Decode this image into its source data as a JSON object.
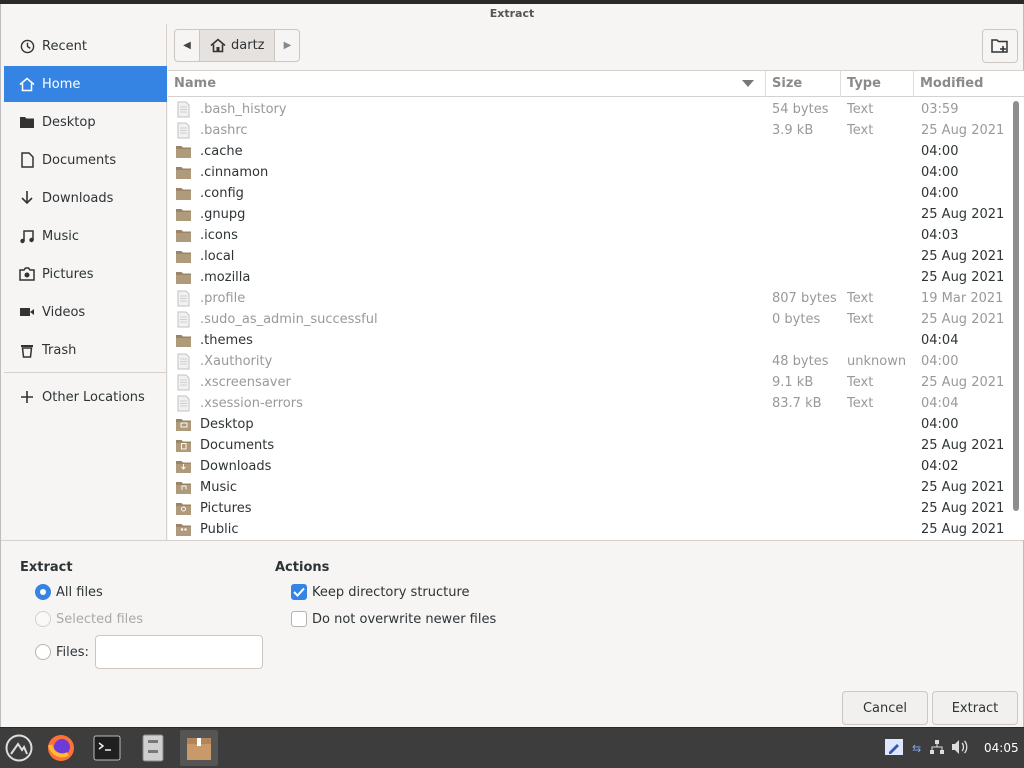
{
  "window": {
    "title": "Extract"
  },
  "sidebar": {
    "items": [
      {
        "label": "Recent",
        "icon": "clock-icon"
      },
      {
        "label": "Home",
        "icon": "home-icon"
      },
      {
        "label": "Desktop",
        "icon": "desktop-folder-icon"
      },
      {
        "label": "Documents",
        "icon": "document-icon"
      },
      {
        "label": "Downloads",
        "icon": "download-icon"
      },
      {
        "label": "Music",
        "icon": "music-icon"
      },
      {
        "label": "Pictures",
        "icon": "camera-icon"
      },
      {
        "label": "Videos",
        "icon": "video-icon"
      },
      {
        "label": "Trash",
        "icon": "trash-icon"
      }
    ],
    "other_locations": "Other Locations"
  },
  "pathbar": {
    "crumb": "dartz"
  },
  "columns": {
    "name": "Name",
    "size": "Size",
    "type": "Type",
    "modified": "Modified"
  },
  "files": [
    {
      "name": ".bash_history",
      "size": "54 bytes",
      "type": "Text",
      "modified": "03:59",
      "kind": "file",
      "hidden": true
    },
    {
      "name": ".bashrc",
      "size": "3.9 kB",
      "type": "Text",
      "modified": "25 Aug 2021",
      "kind": "file",
      "hidden": true
    },
    {
      "name": ".cache",
      "size": "",
      "type": "",
      "modified": "04:00",
      "kind": "folder",
      "hidden": false
    },
    {
      "name": ".cinnamon",
      "size": "",
      "type": "",
      "modified": "04:00",
      "kind": "folder",
      "hidden": false
    },
    {
      "name": ".config",
      "size": "",
      "type": "",
      "modified": "04:00",
      "kind": "folder",
      "hidden": false
    },
    {
      "name": ".gnupg",
      "size": "",
      "type": "",
      "modified": "25 Aug 2021",
      "kind": "folder",
      "hidden": false
    },
    {
      "name": ".icons",
      "size": "",
      "type": "",
      "modified": "04:03",
      "kind": "folder",
      "hidden": false
    },
    {
      "name": ".local",
      "size": "",
      "type": "",
      "modified": "25 Aug 2021",
      "kind": "folder",
      "hidden": false
    },
    {
      "name": ".mozilla",
      "size": "",
      "type": "",
      "modified": "25 Aug 2021",
      "kind": "folder",
      "hidden": false
    },
    {
      "name": ".profile",
      "size": "807 bytes",
      "type": "Text",
      "modified": "19 Mar 2021",
      "kind": "file",
      "hidden": true
    },
    {
      "name": ".sudo_as_admin_successful",
      "size": "0 bytes",
      "type": "Text",
      "modified": "25 Aug 2021",
      "kind": "file",
      "hidden": true
    },
    {
      "name": ".themes",
      "size": "",
      "type": "",
      "modified": "04:04",
      "kind": "folder",
      "hidden": false
    },
    {
      "name": ".Xauthority",
      "size": "48 bytes",
      "type": "unknown",
      "modified": "04:00",
      "kind": "file",
      "hidden": true
    },
    {
      "name": ".xscreensaver",
      "size": "9.1 kB",
      "type": "Text",
      "modified": "25 Aug 2021",
      "kind": "file",
      "hidden": true
    },
    {
      "name": ".xsession-errors",
      "size": "83.7 kB",
      "type": "Text",
      "modified": "04:04",
      "kind": "file",
      "hidden": true
    },
    {
      "name": "Desktop",
      "size": "",
      "type": "",
      "modified": "04:00",
      "kind": "folder-desktop",
      "hidden": false
    },
    {
      "name": "Documents",
      "size": "",
      "type": "",
      "modified": "25 Aug 2021",
      "kind": "folder-documents",
      "hidden": false
    },
    {
      "name": "Downloads",
      "size": "",
      "type": "",
      "modified": "04:02",
      "kind": "folder-downloads",
      "hidden": false
    },
    {
      "name": "Music",
      "size": "",
      "type": "",
      "modified": "25 Aug 2021",
      "kind": "folder-music",
      "hidden": false
    },
    {
      "name": "Pictures",
      "size": "",
      "type": "",
      "modified": "25 Aug 2021",
      "kind": "folder-pictures",
      "hidden": false
    },
    {
      "name": "Public",
      "size": "",
      "type": "",
      "modified": "25 Aug 2021",
      "kind": "folder-public",
      "hidden": false
    }
  ],
  "extract": {
    "heading": "Extract",
    "all_files": "All files",
    "selected_files": "Selected files",
    "files_label": "Files:",
    "files_value": ""
  },
  "actions": {
    "heading": "Actions",
    "keep_structure": "Keep directory structure",
    "keep_structure_checked": true,
    "no_overwrite": "Do not overwrite newer files",
    "no_overwrite_checked": false
  },
  "buttons": {
    "cancel": "Cancel",
    "extract": "Extract"
  },
  "taskbar": {
    "clock": "04:05"
  },
  "colors": {
    "accent": "#3584e4",
    "folder": "#9b8569",
    "taskbar": "#3d3d3d"
  }
}
